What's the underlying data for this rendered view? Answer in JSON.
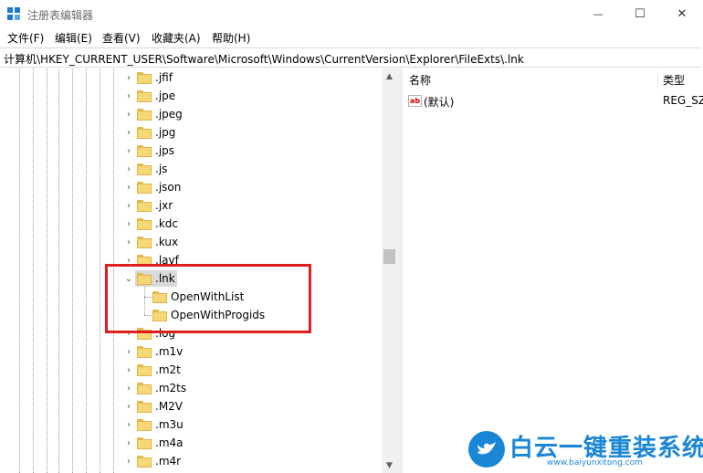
{
  "window": {
    "title": "注册表编辑器",
    "controls": {
      "minimize": "—",
      "maximize": "☐",
      "close": "✕"
    }
  },
  "menu": [
    "文件(F)",
    "编辑(E)",
    "查看(V)",
    "收藏夹(A)",
    "帮助(H)"
  ],
  "address": "计算机\\HKEY_CURRENT_USER\\Software\\Microsoft\\Windows\\CurrentVersion\\Explorer\\FileExts\\.lnk",
  "tree": {
    "before": [
      ".jfif",
      ".jpe",
      ".jpeg",
      ".jpg",
      ".jps",
      ".js",
      ".json",
      ".jxr",
      ".kdc",
      ".kux",
      ".lavf"
    ],
    "selected": ".lnk",
    "children": [
      "OpenWithList",
      "OpenWithProgids"
    ],
    "after": [
      ".log",
      ".m1v",
      ".m2t",
      ".m2ts",
      ".M2V",
      ".m3u",
      ".m4a",
      ".m4r"
    ]
  },
  "values_pane": {
    "columns": {
      "name": "名称",
      "type": "类型"
    },
    "rows": [
      {
        "name": "(默认)",
        "type": "REG_SZ",
        "icon": "ab"
      }
    ]
  },
  "watermark": {
    "title": "白云一键重装系统",
    "url": "www.baiyunxitong.com"
  },
  "colors": {
    "highlight": "#e01e1e",
    "folder": "#f8d775",
    "selection": "#d9d9d9",
    "brand": "#1a86d6"
  }
}
